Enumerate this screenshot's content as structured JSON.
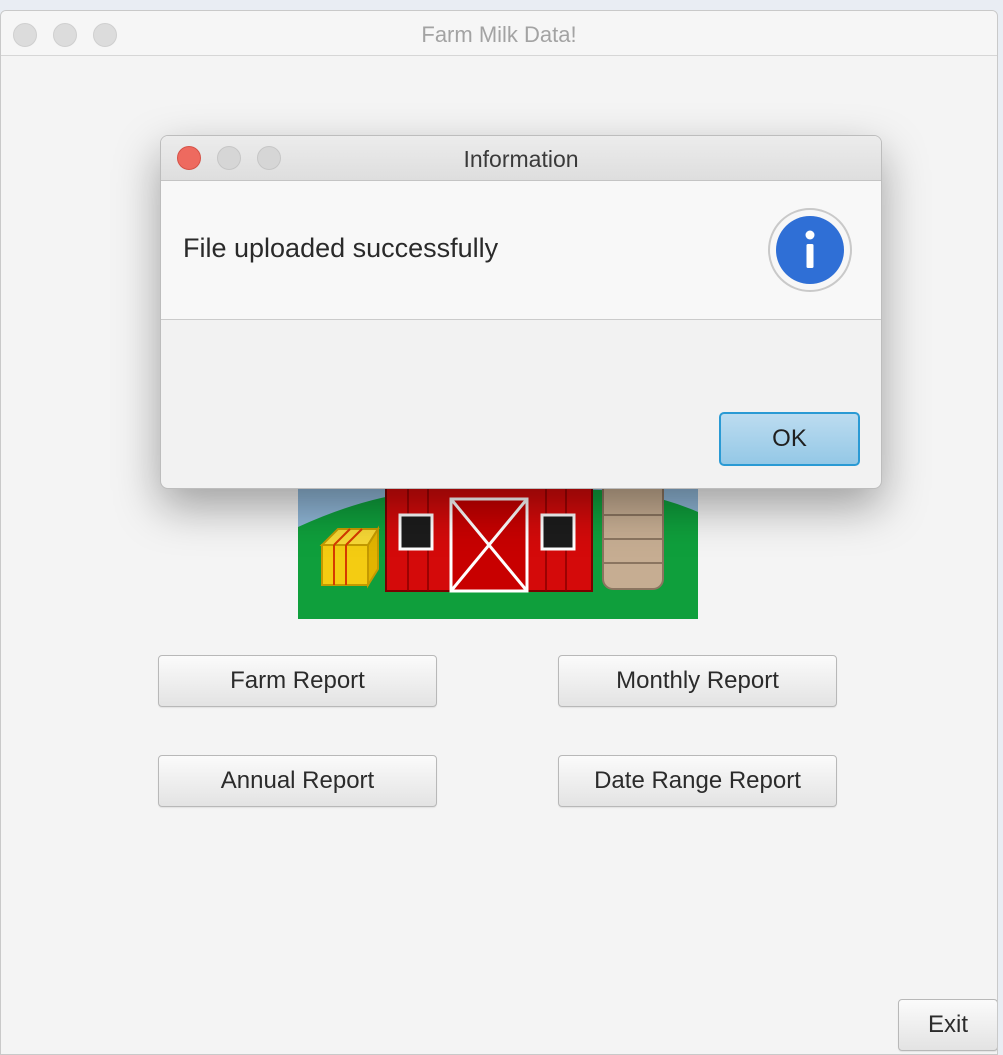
{
  "window": {
    "title": "Farm Milk Data!"
  },
  "buttons": {
    "farm_report": "Farm Report",
    "monthly_report": "Monthly Report",
    "annual_report": "Annual Report",
    "date_range_report": "Date Range Report",
    "exit": "Exit"
  },
  "dialog": {
    "title": "Information",
    "message": "File uploaded successfully",
    "ok": "OK",
    "icon": "info-icon"
  },
  "colors": {
    "close_button": "#ee6a5f",
    "ok_accent": "#2a9ad4",
    "info_icon": "#2f6fd6",
    "barn_red": "#d40a0a",
    "grass": "#0f9f3c",
    "sky": "#8fb6d6"
  }
}
